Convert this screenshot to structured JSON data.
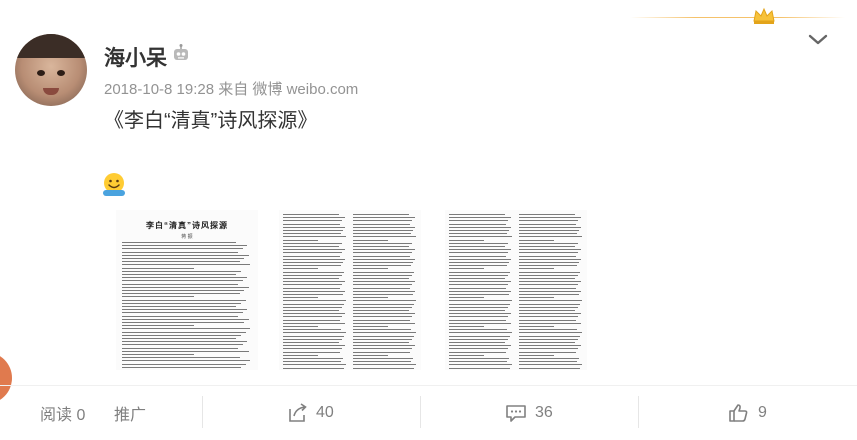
{
  "post": {
    "username": "海小呆",
    "meta": "2018-10-8 19:28 来自 微博 weibo.com",
    "title": "《李白“清真”诗风探源》",
    "images": [
      {
        "title": "李白“清真”诗风探源",
        "author": "蒋 振"
      },
      {},
      {}
    ]
  },
  "actions": {
    "read": "阅读 0",
    "promote": "推广",
    "repost_count": "40",
    "comment_count": "36",
    "like_count": "9"
  },
  "colors": {
    "accent_gold": "#f5c26b",
    "meta_gray": "#939393",
    "side_tab": "#e07a4e"
  },
  "icons": [
    "crown-icon",
    "robot-icon",
    "chevron-down-icon",
    "smile-emoji-icon",
    "repost-icon",
    "comment-icon",
    "like-icon"
  ]
}
